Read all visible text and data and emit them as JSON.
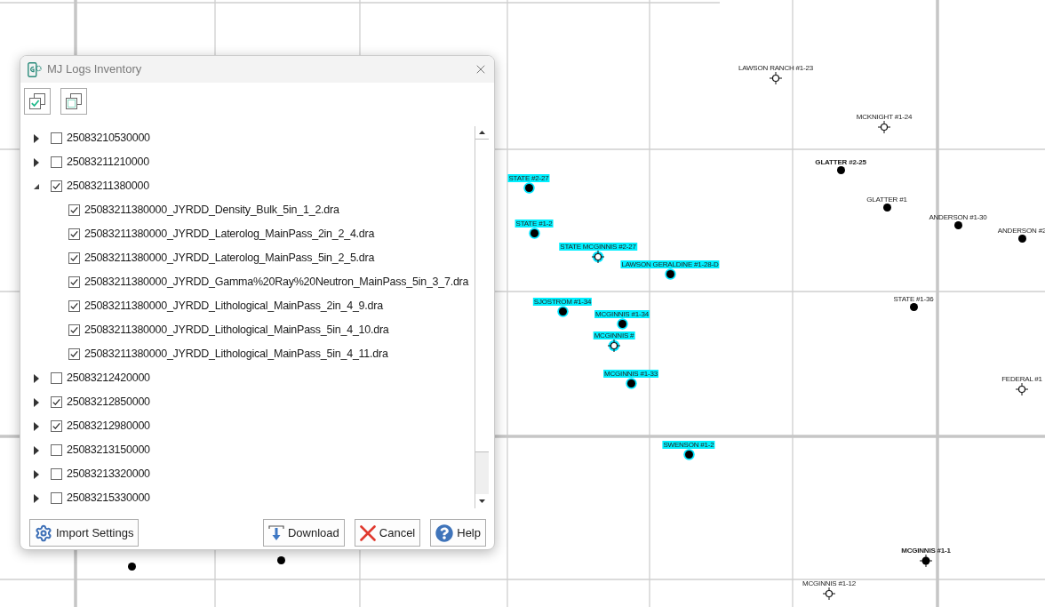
{
  "map": {
    "wells": [
      {
        "label": "LAWSON RANCH #1-23",
        "kind": "open",
        "highlighted": false,
        "bold": false
      },
      {
        "label": "MCKNIGHT #1-24",
        "kind": "open",
        "highlighted": false,
        "bold": false
      },
      {
        "label": "GLATTER #2-25",
        "kind": "filled",
        "highlighted": false,
        "bold": true
      },
      {
        "label": "GLATTER #1",
        "kind": "filled",
        "highlighted": false,
        "bold": false
      },
      {
        "label": "ANDERSON #1-30",
        "kind": "filled",
        "highlighted": false,
        "bold": false
      },
      {
        "label": "ANDERSON #2",
        "kind": "filled",
        "highlighted": false,
        "bold": false
      },
      {
        "label": "STATE #2-27",
        "kind": "filled",
        "highlighted": true,
        "bold": false
      },
      {
        "label": "STATE #1-2",
        "kind": "filled",
        "highlighted": true,
        "bold": false
      },
      {
        "label": "STATE MCGINNIS #2-27",
        "kind": "open",
        "highlighted": true,
        "bold": false
      },
      {
        "label": "LAWSON GERALDINE #1-28-D",
        "kind": "filled",
        "highlighted": true,
        "bold": false
      },
      {
        "label": "SJOSTROM #1-34",
        "kind": "filled",
        "highlighted": true,
        "bold": false
      },
      {
        "label": "MCGINNIS #1-34",
        "kind": "filled",
        "highlighted": true,
        "bold": false
      },
      {
        "label": "MCGINNIS #",
        "kind": "open",
        "highlighted": true,
        "bold": false
      },
      {
        "label": "MCGINNIS #1-33",
        "kind": "filled",
        "highlighted": true,
        "bold": false
      },
      {
        "label": "SWENSON #1-2",
        "kind": "filled",
        "highlighted": true,
        "bold": false
      },
      {
        "label": "STATE #1-36",
        "kind": "filled",
        "highlighted": false,
        "bold": false
      },
      {
        "label": "FEDERAL #1",
        "kind": "open",
        "highlighted": false,
        "bold": false
      },
      {
        "label": "MCGINNIS #1-1",
        "kind": "filled_cross",
        "highlighted": false,
        "bold": true
      },
      {
        "label": "MCGINNIS #1-12",
        "kind": "open",
        "highlighted": false,
        "bold": false
      },
      {
        "kind": "filled",
        "highlighted": false
      },
      {
        "kind": "filled",
        "highlighted": false
      }
    ]
  },
  "dialog": {
    "title": "MJ Logs Inventory",
    "toolbar": [
      {
        "kind": "check_all"
      },
      {
        "kind": "uncheck_all"
      }
    ],
    "tree": {
      "items": [
        {
          "label": "25083210530000",
          "checked": false,
          "expanded": false
        },
        {
          "label": "25083211210000",
          "checked": false,
          "expanded": false
        },
        {
          "label": "25083211380000",
          "checked": true,
          "expanded": true,
          "children": [
            {
              "label": "25083211380000_JYRDD_Density_Bulk_5in_1_2.dra",
              "checked": true
            },
            {
              "label": "25083211380000_JYRDD_Laterolog_MainPass_2in_2_4.dra",
              "checked": true
            },
            {
              "label": "25083211380000_JYRDD_Laterolog_MainPass_5in_2_5.dra",
              "checked": true
            },
            {
              "label": "25083211380000_JYRDD_Gamma%20Ray%20Neutron_MainPass_5in_3_7.dra",
              "checked": true
            },
            {
              "label": "25083211380000_JYRDD_Lithological_MainPass_2in_4_9.dra",
              "checked": true
            },
            {
              "label": "25083211380000_JYRDD_Lithological_MainPass_5in_4_10.dra",
              "checked": true
            },
            {
              "label": "25083211380000_JYRDD_Lithological_MainPass_5in_4_11.dra",
              "checked": true
            }
          ]
        },
        {
          "label": "25083212420000",
          "checked": false,
          "expanded": false
        },
        {
          "label": "25083212850000",
          "checked": true,
          "expanded": false
        },
        {
          "label": "25083212980000",
          "checked": true,
          "expanded": false
        },
        {
          "label": "25083213150000",
          "checked": false,
          "expanded": false
        },
        {
          "label": "25083213320000",
          "checked": false,
          "expanded": false
        },
        {
          "label": "25083215330000",
          "checked": false,
          "expanded": false
        }
      ]
    },
    "buttons_left": [
      {
        "kind": "import",
        "label": "Import Settings"
      }
    ],
    "buttons_right": [
      {
        "kind": "download",
        "label": "Download"
      },
      {
        "kind": "cancel",
        "label": "Cancel"
      },
      {
        "kind": "help",
        "label": "Help"
      }
    ]
  }
}
